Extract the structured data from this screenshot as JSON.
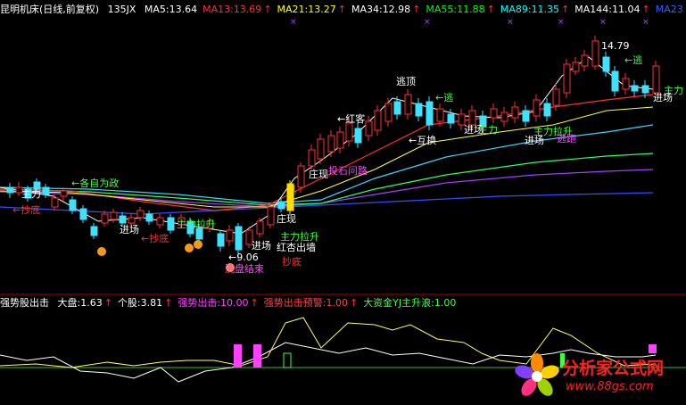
{
  "top_header": {
    "title": "昆明机床(日线,前复权)",
    "period": "135JX",
    "ma": [
      {
        "label": "MA5:13.64",
        "color": "#ffffff",
        "arrow": ""
      },
      {
        "label": "MA13:13.69",
        "color": "#ff3030",
        "arrow": "↑"
      },
      {
        "label": "MA21:13.27",
        "color": "#ffff00",
        "arrow": "↑"
      },
      {
        "label": "MA34:12.98",
        "color": "#ffffff",
        "arrow": "↑"
      },
      {
        "label": "MA55:11.88",
        "color": "#00ff00",
        "arrow": "↑"
      },
      {
        "label": "MA89:11.35",
        "color": "#00ffff",
        "arrow": "↑"
      },
      {
        "label": "MA144:11.04",
        "color": "#ffffff",
        "arrow": "↑"
      },
      {
        "label": "MA23",
        "color": "#3060ff",
        "arrow": ""
      }
    ]
  },
  "sub_header": {
    "title": "强势股出击",
    "items": [
      {
        "label": "大盘:1.63",
        "color": "#ffffff",
        "arrow": "↑"
      },
      {
        "label": "个股:3.81",
        "color": "#ffffff",
        "arrow": "↑"
      },
      {
        "label": "强势出击:10.00",
        "color": "#ff40ff",
        "arrow": "↑"
      },
      {
        "label": "强势出击预警:1.00",
        "color": "#ff4040",
        "arrow": "↑"
      },
      {
        "label": "大资金YJ主升浪:1.00",
        "color": "#40ff40",
        "arrow": ""
      }
    ]
  },
  "annotations": [
    {
      "text": "←各自为政",
      "color": "#40ff40"
    },
    {
      "text": "主力",
      "color": "#ffffff"
    },
    {
      "text": "←抄底",
      "color": "#ff3030"
    },
    {
      "text": "进场",
      "color": "#ffffff"
    },
    {
      "text": "主力拉升",
      "color": "#40ff40"
    },
    {
      "text": "←抄底",
      "color": "#ff3030"
    },
    {
      "text": "←9.06",
      "color": "#ffffff"
    },
    {
      "text": "洗盘结束",
      "color": "#ff40ff"
    },
    {
      "text": "进场",
      "color": "#ffffff"
    },
    {
      "text": "红杏出墙",
      "color": "#ffffff"
    },
    {
      "text": "主力拉升",
      "color": "#40ff40"
    },
    {
      "text": "抄底",
      "color": "#ff3030"
    },
    {
      "text": "庄现",
      "color": "#ffffff"
    },
    {
      "text": "庄现",
      "color": "#ffffff"
    },
    {
      "text": "投石问路",
      "color": "#ff40ff"
    },
    {
      "text": "←红客",
      "color": "#ffffff"
    },
    {
      "text": "逃顶",
      "color": "#ffffff"
    },
    {
      "text": "←逃",
      "color": "#40ff40"
    },
    {
      "text": "←互换",
      "color": "#ffffff"
    },
    {
      "text": "进场",
      "color": "#ffffff"
    },
    {
      "text": "主力",
      "color": "#40ff40"
    },
    {
      "text": "进场",
      "color": "#ffffff"
    },
    {
      "text": "主力拉升",
      "color": "#40ff40"
    },
    {
      "text": "逃跑",
      "color": "#ff40ff"
    },
    {
      "text": "14.79",
      "color": "#ffffff"
    },
    {
      "text": "←逃",
      "color": "#40ff40"
    },
    {
      "text": "主力",
      "color": "#40ff40"
    },
    {
      "text": "进场",
      "color": "#ffffff"
    }
  ],
  "watermark": {
    "site_name": "分析家公式网",
    "url": "www.88gs.com"
  },
  "colors": {
    "background": "#000000",
    "up_candle": "#ff3030",
    "down_candle": "#40e0ff",
    "divider": "#a00000"
  },
  "chart_data": {
    "type": "candlestick",
    "high_marker": 14.79,
    "low_marker": 9.06
  }
}
